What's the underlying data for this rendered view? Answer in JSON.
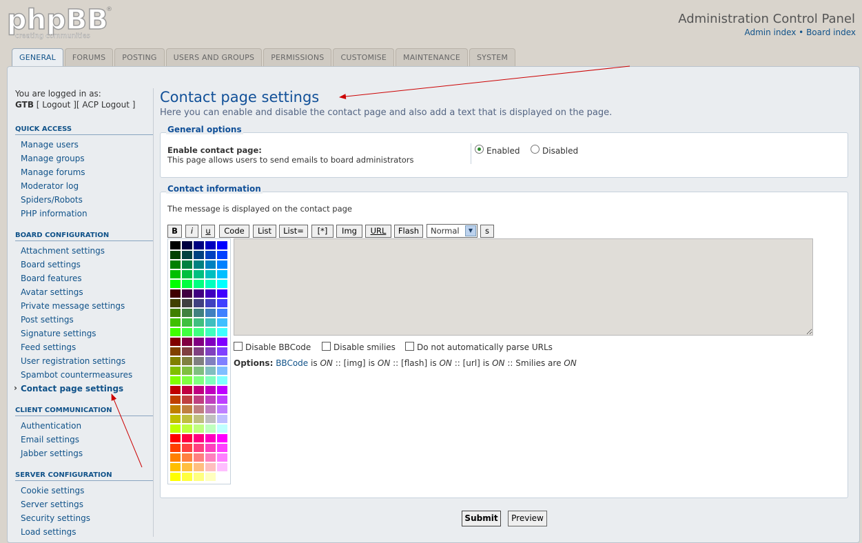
{
  "header": {
    "logo_text": "phpBB",
    "logo_tagline": "creating  communities",
    "title": "Administration Control Panel",
    "links": [
      "Admin index",
      "Board index"
    ],
    "link_separator": "•"
  },
  "tabs": [
    "GENERAL",
    "FORUMS",
    "POSTING",
    "USERS AND GROUPS",
    "PERMISSIONS",
    "CUSTOMISE",
    "MAINTENANCE",
    "SYSTEM"
  ],
  "active_tab": "GENERAL",
  "login": {
    "line1": "You are logged in as:",
    "user": "GTB",
    "logout": "Logout",
    "acp_logout": "ACP Logout"
  },
  "sidebar": {
    "sections": [
      {
        "title": "QUICK ACCESS",
        "items": [
          "Manage users",
          "Manage groups",
          "Manage forums",
          "Moderator log",
          "Spiders/Robots",
          "PHP information"
        ]
      },
      {
        "title": "BOARD CONFIGURATION",
        "items": [
          "Attachment settings",
          "Board settings",
          "Board features",
          "Avatar settings",
          "Private message settings",
          "Post settings",
          "Signature settings",
          "Feed settings",
          "User registration settings",
          "Spambot countermeasures",
          "Contact page settings"
        ]
      },
      {
        "title": "CLIENT COMMUNICATION",
        "items": [
          "Authentication",
          "Email settings",
          "Jabber settings"
        ]
      },
      {
        "title": "SERVER CONFIGURATION",
        "items": [
          "Cookie settings",
          "Server settings",
          "Security settings",
          "Load settings"
        ]
      }
    ],
    "active_item": "Contact page settings"
  },
  "content": {
    "title": "Contact page settings",
    "description": "Here you can enable and disable the contact page and also add a text that is displayed on the page.",
    "general": {
      "legend": "General options",
      "label": "Enable contact page:",
      "explain": "This page allows users to send emails to board administrators",
      "enabled_label": "Enabled",
      "disabled_label": "Disabled",
      "enabled": true
    },
    "contact": {
      "legend": "Contact information",
      "message_desc": "The message is displayed on the contact page",
      "toolbar": [
        "B",
        "i",
        "u",
        "Code",
        "List",
        "List=",
        "[*]",
        "Img",
        "URL",
        "Flash"
      ],
      "font_size": "Normal",
      "extra_btn": "s",
      "message_value": "",
      "checkboxes": [
        "Disable BBCode",
        "Disable smilies",
        "Do not automatically parse URLs"
      ],
      "options": {
        "label": "Options:",
        "bbcode": "BBCode",
        "is": "is",
        "on": "ON",
        "img": "[img]",
        "flash": "[flash]",
        "url": "[url]",
        "smilies": "Smilies are",
        "sep": "::"
      }
    },
    "submit_label": "Submit",
    "preview_label": "Preview"
  },
  "palette_colors": [
    "#000000",
    "#000040",
    "#000080",
    "#0000BF",
    "#0000FF",
    "#004000",
    "#004040",
    "#004080",
    "#0040BF",
    "#0040FF",
    "#008000",
    "#008040",
    "#008080",
    "#0080BF",
    "#0080FF",
    "#00BF00",
    "#00BF40",
    "#00BF80",
    "#00BFBF",
    "#00BFFF",
    "#00FF00",
    "#00FF40",
    "#00FF80",
    "#00FFBF",
    "#00FFFF",
    "#400000",
    "#400040",
    "#400080",
    "#4000BF",
    "#4000FF",
    "#404000",
    "#404040",
    "#404080",
    "#4040BF",
    "#4040FF",
    "#408000",
    "#408040",
    "#408080",
    "#4080BF",
    "#4080FF",
    "#40BF00",
    "#40BF40",
    "#40BF80",
    "#40BFBF",
    "#40BFFF",
    "#40FF00",
    "#40FF40",
    "#40FF80",
    "#40FFBF",
    "#40FFFF",
    "#800000",
    "#800040",
    "#800080",
    "#8000BF",
    "#8000FF",
    "#804000",
    "#804040",
    "#804080",
    "#8040BF",
    "#8040FF",
    "#808000",
    "#808040",
    "#808080",
    "#8080BF",
    "#8080FF",
    "#80BF00",
    "#80BF40",
    "#80BF80",
    "#80BFBF",
    "#80BFFF",
    "#80FF00",
    "#80FF40",
    "#80FF80",
    "#80FFBF",
    "#80FFFF",
    "#BF0000",
    "#BF0040",
    "#BF0080",
    "#BF00BF",
    "#BF00FF",
    "#BF4000",
    "#BF4040",
    "#BF4080",
    "#BF40BF",
    "#BF40FF",
    "#BF8000",
    "#BF8040",
    "#BF8080",
    "#BF80BF",
    "#BF80FF",
    "#BFBF00",
    "#BFBF40",
    "#BFBF80",
    "#BFBFBF",
    "#BFBFFF",
    "#BFFF00",
    "#BFFF40",
    "#BFFF80",
    "#BFFFBF",
    "#BFFFFF",
    "#FF0000",
    "#FF0040",
    "#FF0080",
    "#FF00BF",
    "#FF00FF",
    "#FF4000",
    "#FF4040",
    "#FF4080",
    "#FF40BF",
    "#FF40FF",
    "#FF8000",
    "#FF8040",
    "#FF8080",
    "#FF80BF",
    "#FF80FF",
    "#FFBF00",
    "#FFBF40",
    "#FFBF80",
    "#FFBFBF",
    "#FFBFFF",
    "#FFFF00",
    "#FFFF40",
    "#FFFF80",
    "#FFFFBF",
    "#FFFFFF"
  ],
  "colors": {
    "link": "#105289",
    "title": "#115098",
    "annotation_arrow": "#cc0000"
  }
}
